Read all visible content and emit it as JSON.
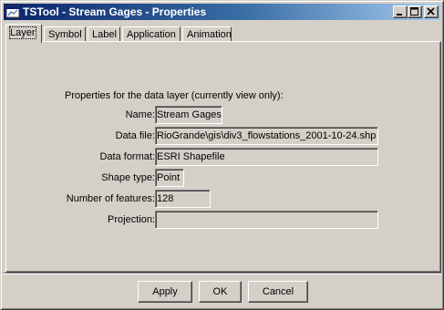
{
  "window": {
    "title": "TSTool - Stream Gages - Properties",
    "icon": "app-window-icon",
    "controls": [
      "minimize-icon",
      "maximize-icon",
      "close-icon"
    ]
  },
  "tabs": [
    {
      "label": "Layer",
      "active": true
    },
    {
      "label": "Symbol",
      "active": false
    },
    {
      "label": "Label",
      "active": false
    },
    {
      "label": "Application",
      "active": false
    },
    {
      "label": "Animation",
      "active": false
    }
  ],
  "layer": {
    "heading": "Properties for the data layer (currently view only):",
    "fields": [
      {
        "label": "Name:",
        "value": "Stream Gages"
      },
      {
        "label": "Data file:",
        "value": "RioGrande\\gis\\div3_flowstations_2001-10-24.shp"
      },
      {
        "label": "Data format:",
        "value": "ESRI Shapefile"
      },
      {
        "label": "Shape type:",
        "value": "Point"
      },
      {
        "label": "Number of features:",
        "value": "128"
      },
      {
        "label": "Projection:",
        "value": ""
      }
    ]
  },
  "buttons": {
    "apply": "Apply",
    "ok": "OK",
    "cancel": "Cancel"
  }
}
